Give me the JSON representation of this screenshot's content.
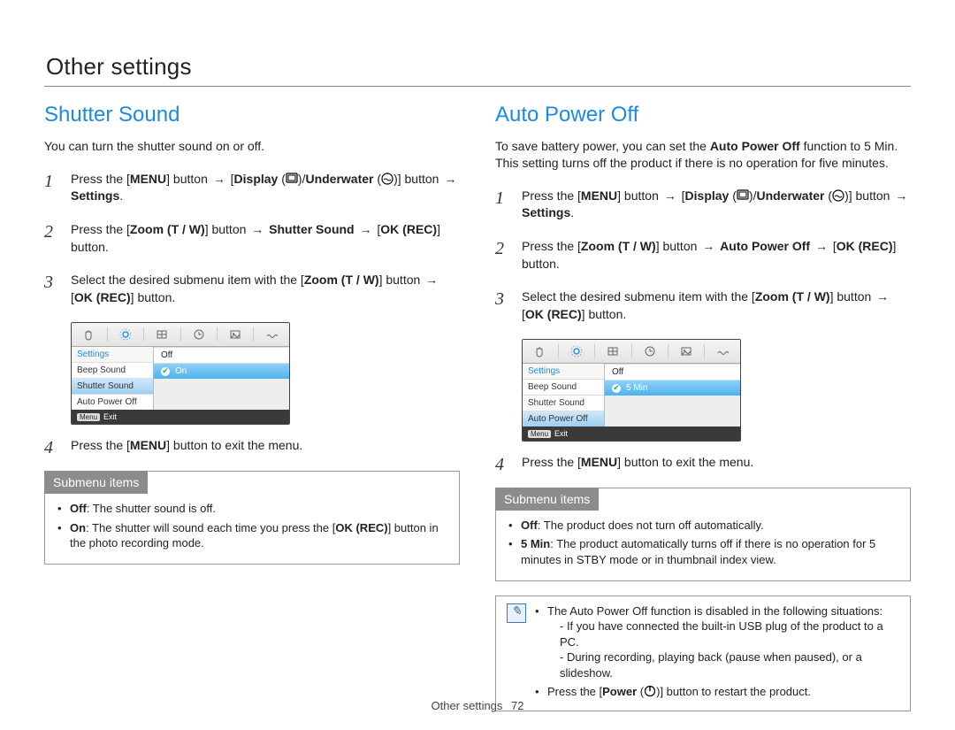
{
  "page": {
    "title": "Other settings",
    "footer_label": "Other settings",
    "page_number": "72"
  },
  "arrow": "→",
  "icons": {
    "display": "display-icon",
    "underwater": "underwater-icon",
    "power": "power-icon",
    "note": "note-icon"
  },
  "left": {
    "heading": "Shutter Sound",
    "intro": "You can turn the shutter sound on or off.",
    "steps": [
      {
        "parts": [
          "Press the [",
          "MENU",
          "] button ",
          "ARROW",
          " [",
          "Display",
          " (",
          "ICON:display",
          ")/",
          "Underwater",
          " (",
          "ICON:underwater",
          ")] button ",
          "ARROW",
          " ",
          "Settings",
          "."
        ]
      },
      {
        "parts": [
          "Press the [",
          "Zoom (T / W)",
          "] button ",
          "ARROW",
          " ",
          "Shutter Sound",
          " ",
          "ARROW",
          " [",
          "OK (REC)",
          "] button."
        ]
      },
      {
        "parts": [
          "Select the desired submenu item with the [",
          "Zoom (T / W)",
          "] button ",
          "ARROW",
          " [",
          "OK (REC)",
          "] button."
        ]
      },
      {
        "parts": [
          "Press the [",
          "MENU",
          "] button to exit the menu."
        ]
      }
    ],
    "mock": {
      "left_header": "Settings",
      "rows": [
        "Beep Sound",
        "Shutter Sound",
        "Auto Power Off"
      ],
      "selected_row_index": 1,
      "options": [
        "Off",
        "On"
      ],
      "selected_option_index": 1,
      "exit_key": "Menu",
      "exit_label": "Exit"
    },
    "submenu": {
      "title": "Submenu items",
      "items": [
        {
          "label": "Off",
          "text": ": The shutter sound is off."
        },
        {
          "label": "On",
          "text": ": The shutter will sound each time you press the [OK (REC)] button in the photo recording mode."
        }
      ]
    }
  },
  "right": {
    "heading": "Auto Power Off",
    "intro_pre": "To save battery power, you can set the ",
    "intro_bold": "Auto Power Off",
    "intro_post": " function to 5 Min. This setting turns off the product if there is no operation for five minutes.",
    "steps": [
      {
        "parts": [
          "Press the [",
          "MENU",
          "] button ",
          "ARROW",
          " [",
          "Display",
          " (",
          "ICON:display",
          ")/",
          "Underwater",
          " (",
          "ICON:underwater",
          ")] button ",
          "ARROW",
          " ",
          "Settings",
          "."
        ]
      },
      {
        "parts": [
          "Press the [",
          "Zoom (T / W)",
          "] button ",
          "ARROW",
          " ",
          "Auto Power Off",
          " ",
          "ARROW",
          " [",
          "OK (REC)",
          "] button."
        ]
      },
      {
        "parts": [
          "Select the desired submenu item with the [",
          "Zoom (T / W)",
          "] button ",
          "ARROW",
          " [",
          "OK (REC)",
          "] button."
        ]
      },
      {
        "parts": [
          "Press the [",
          "MENU",
          "] button to exit the menu."
        ]
      }
    ],
    "mock": {
      "left_header": "Settings",
      "rows": [
        "Beep Sound",
        "Shutter Sound",
        "Auto Power Off"
      ],
      "selected_row_index": 2,
      "options": [
        "Off",
        "5 Min"
      ],
      "selected_option_index": 1,
      "exit_key": "Menu",
      "exit_label": "Exit"
    },
    "submenu": {
      "title": "Submenu items",
      "items": [
        {
          "label": "Off",
          "text": ": The product does not turn off automatically."
        },
        {
          "label": "5 Min",
          "text": ": The product automatically turns off if there is no operation for 5 minutes in STBY mode or in thumbnail index view."
        }
      ]
    },
    "note": {
      "lead": "The Auto Power Off function is disabled in the following situations:",
      "subs": [
        "- If you have connected the built-in USB plug of the product to a PC.",
        "- During recording, playing back (pause when paused), or a slideshow."
      ],
      "line2_pre": "Press the [",
      "line2_bold": "Power",
      "line2_post": ")] button to restart the product."
    }
  }
}
